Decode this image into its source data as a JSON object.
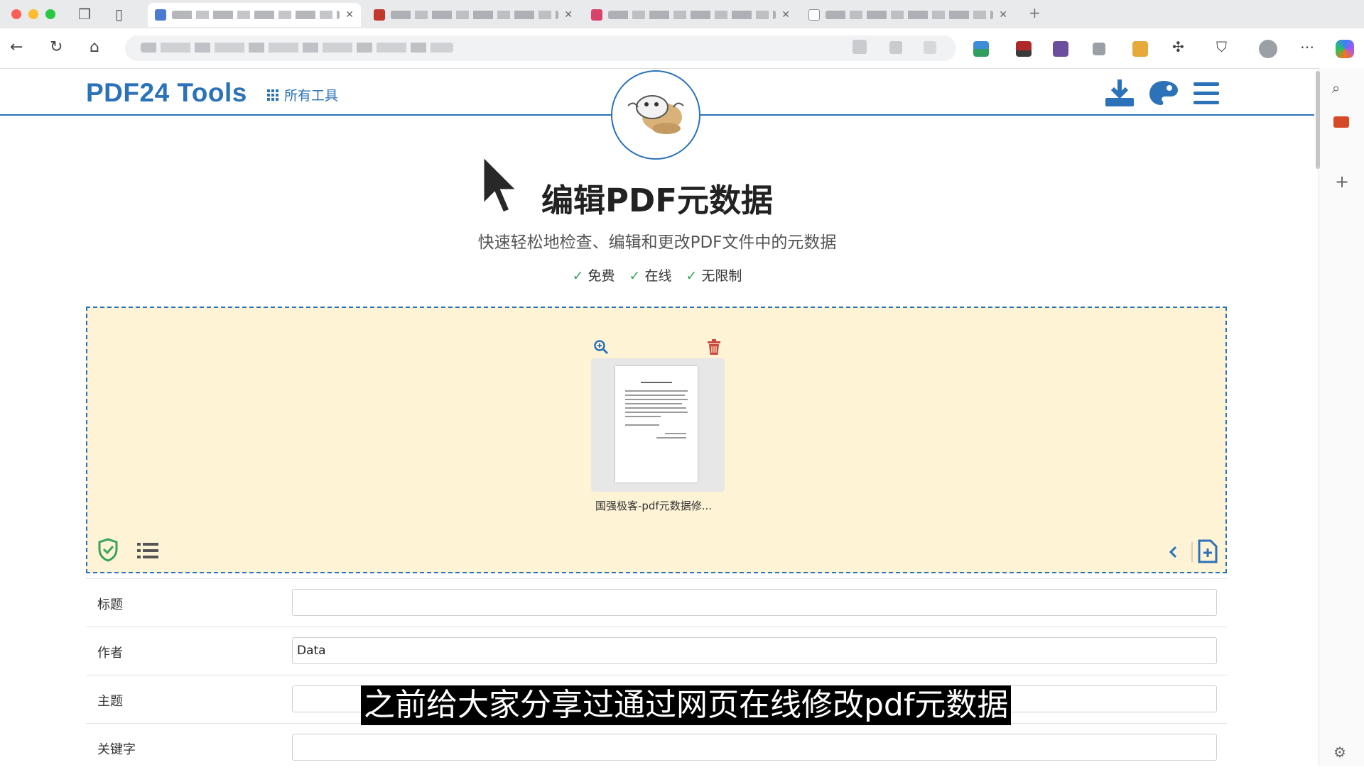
{
  "browser": {
    "tabs": [
      {
        "fav_color": "#4a7bd0",
        "active": true
      },
      {
        "fav_color": "#c0392b",
        "active": false
      },
      {
        "fav_color": "#d9436a",
        "active": false
      },
      {
        "fav_color": "#8a8f96",
        "active": false
      }
    ],
    "new_tab_label": "+"
  },
  "header": {
    "logo": "PDF24 Tools",
    "all_tools": "所有工具"
  },
  "main": {
    "title": "编辑PDF元数据",
    "subtitle": "快速轻松地检查、编辑和更改PDF文件中的元数据",
    "features": [
      "免费",
      "在线",
      "无限制"
    ]
  },
  "dropzone": {
    "file_name": "国强极客-pdf元数据修..."
  },
  "form": {
    "fields": [
      {
        "label": "标题",
        "value": ""
      },
      {
        "label": "作者",
        "value": "Data"
      },
      {
        "label": "主题",
        "value": ""
      },
      {
        "label": "关键字",
        "value": ""
      }
    ]
  },
  "caption": "之前给大家分享过通过网页在线修改pdf元数据",
  "colors": {
    "brand": "#2b72b8",
    "dropzone_bg": "#fff3d6",
    "check_green": "#3aa35a",
    "delete_red": "#c94a3c"
  }
}
